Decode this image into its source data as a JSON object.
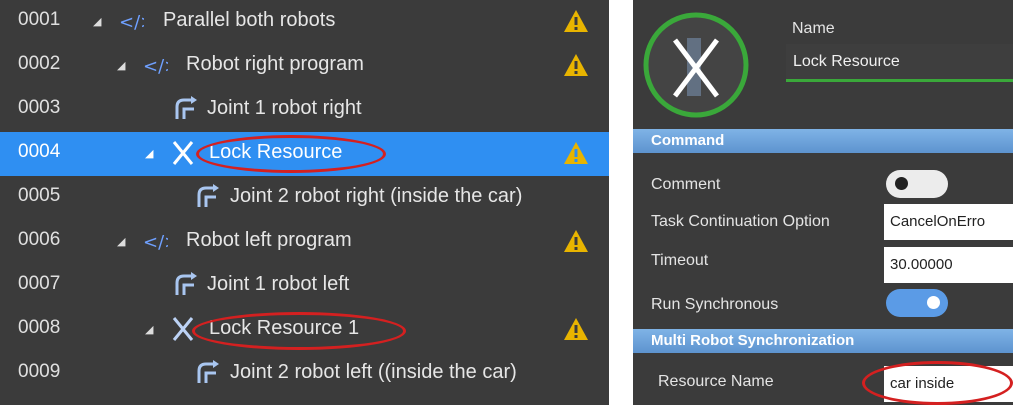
{
  "tree": {
    "rows": [
      {
        "line": "0001",
        "label": "Parallel both robots",
        "icon": "code-brackets-icon",
        "expandable": true,
        "warning": true
      },
      {
        "line": "0002",
        "label": "Robot right program",
        "icon": "code-brackets-icon",
        "expandable": true,
        "warning": true
      },
      {
        "line": "0003",
        "label": "Joint 1 robot right",
        "icon": "joint-move-icon",
        "expandable": false,
        "warning": false
      },
      {
        "line": "0004",
        "label": "Lock Resource",
        "icon": "lock-resource-icon",
        "expandable": true,
        "warning": true,
        "selected": true
      },
      {
        "line": "0005",
        "label": "Joint 2 robot right (inside the car)",
        "icon": "joint-move-icon",
        "expandable": false,
        "warning": false
      },
      {
        "line": "0006",
        "label": "Robot left program",
        "icon": "code-brackets-icon",
        "expandable": true,
        "warning": true
      },
      {
        "line": "0007",
        "label": "Joint 1 robot left",
        "icon": "joint-move-icon",
        "expandable": false,
        "warning": false
      },
      {
        "line": "0008",
        "label": "Lock Resource 1",
        "icon": "lock-resource-icon",
        "expandable": true,
        "warning": true
      },
      {
        "line": "0009",
        "label": "Joint 2 robot left ((inside the car)",
        "icon": "joint-move-icon",
        "expandable": false,
        "warning": false
      }
    ]
  },
  "props": {
    "name_label": "Name",
    "name_value": "Lock Resource",
    "command_section": "Command",
    "comment_label": "Comment",
    "comment_on": false,
    "task_continuation_label": "Task Continuation Option",
    "task_continuation_value": "CancelOnErro",
    "timeout_label": "Timeout",
    "timeout_value": "30.00000",
    "run_sync_label": "Run Synchronous",
    "run_sync_on": true,
    "multi_robot_section": "Multi Robot Synchronization",
    "resource_name_label": "Resource Name",
    "resource_name_value": "car inside"
  },
  "colors": {
    "panel_bg": "#3b3b3b",
    "selection": "#2f8ff2",
    "section_header": "#6fa3dc",
    "warning": "#e8b400",
    "highlight_oval": "#d42020",
    "icon_ring": "#3aa83a",
    "toggle_on": "#5b9be6"
  }
}
